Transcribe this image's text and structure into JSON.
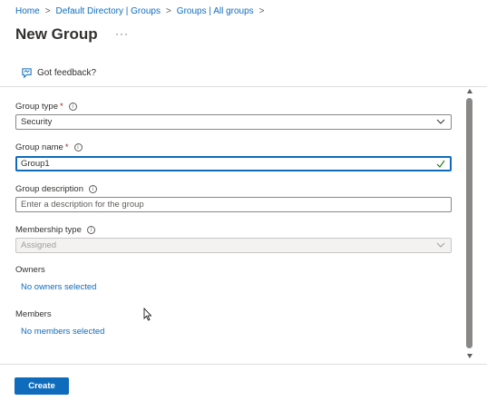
{
  "breadcrumb": {
    "items": [
      "Home",
      "Default Directory | Groups",
      "Groups | All groups"
    ],
    "separator": ">"
  },
  "page": {
    "title": "New Group",
    "more_label": "···"
  },
  "toolbar": {
    "feedback_label": "Got feedback?"
  },
  "form": {
    "group_type": {
      "label": "Group type",
      "required_mark": "*",
      "value": "Security"
    },
    "group_name": {
      "label": "Group name",
      "required_mark": "*",
      "value": "Group1"
    },
    "group_description": {
      "label": "Group description",
      "placeholder": "Enter a description for the group"
    },
    "membership_type": {
      "label": "Membership type",
      "value": "Assigned"
    },
    "owners": {
      "label": "Owners",
      "link": "No owners selected"
    },
    "members": {
      "label": "Members",
      "link": "No members selected"
    }
  },
  "footer": {
    "create_label": "Create"
  },
  "colors": {
    "accent": "#0f6cbd",
    "required": "#a4262c",
    "valid_check": "#107c10"
  },
  "icons": {
    "info": "info-icon",
    "feedback": "feedback-icon",
    "dropdown": "chevron-down-icon",
    "valid": "checkmark-icon"
  }
}
